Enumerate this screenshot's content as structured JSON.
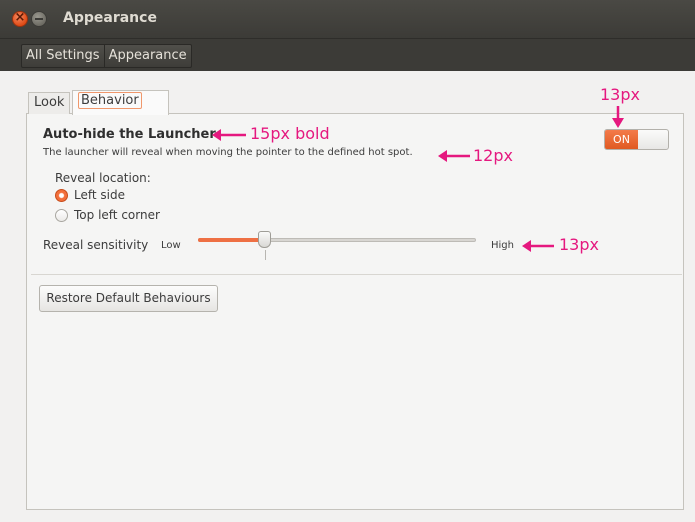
{
  "window": {
    "title": "Appearance"
  },
  "toolbar": {
    "crumbs": [
      "All Settings",
      "Appearance"
    ]
  },
  "tabs": [
    {
      "label": "Look"
    },
    {
      "label": "Behavior"
    }
  ],
  "behavior": {
    "autohide_label": "Auto-hide the Launcher",
    "autohide_description": "The launcher will reveal when moving the pointer to the defined hot spot.",
    "switch_state": "ON",
    "reveal_location_label": "Reveal location:",
    "reveal_options": [
      {
        "label": "Left side",
        "selected": true
      },
      {
        "label": "Top left corner",
        "selected": false
      }
    ],
    "sensitivity_label": "Reveal sensitivity",
    "sensitivity_low": "Low",
    "sensitivity_high": "High",
    "sensitivity_value_fraction": 0.24,
    "restore_button": "Restore Default Behaviours"
  },
  "annotations": {
    "heading_note": "15px bold",
    "description_note": "12px",
    "switch_note": "13px",
    "slider_note": "13px",
    "color": "#e5187f"
  },
  "colors": {
    "accent": "#f07746",
    "titlebar": "#3c3b37"
  }
}
